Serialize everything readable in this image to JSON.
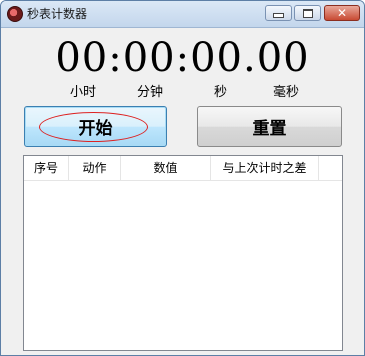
{
  "window": {
    "title": "秒表计数器",
    "icon": "stopwatch-icon",
    "controls": {
      "minimize": "minimize-icon",
      "maximize": "maximize-icon",
      "close": "close-icon"
    }
  },
  "timer": {
    "display": "00:00:00.00",
    "units": [
      "小时",
      "分钟",
      "秒",
      "毫秒"
    ]
  },
  "buttons": {
    "start": "开始",
    "reset": "重置"
  },
  "list": {
    "columns": [
      "序号",
      "动作",
      "数值",
      "与上次计时之差"
    ],
    "rows": []
  },
  "colors": {
    "highlight_oval": "#dd2222",
    "start_button_border": "#3c7fb1"
  }
}
